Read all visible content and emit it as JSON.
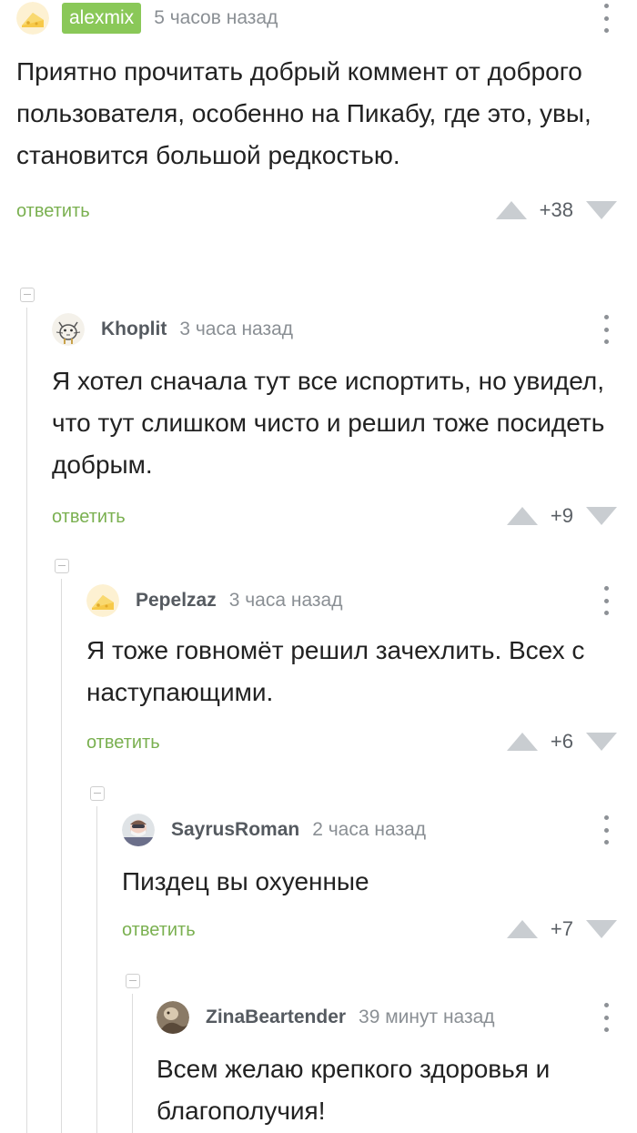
{
  "comments": [
    {
      "username": "alexmix",
      "time": "5 часов назад",
      "text": "Приятно прочитать добрый коммент от доброго пользователя, особенно на Пикабу, где это, увы, становится большой редкостью.",
      "reply_label": "ответить",
      "score": "+38",
      "avatar_icon": "cheese-icon"
    },
    {
      "username": "Khoplit",
      "time": "3 часа назад",
      "text": "Я хотел сначала тут все испортить, но увидел, что тут слишком чисто и решил тоже посидеть добрым.",
      "reply_label": "ответить",
      "score": "+9",
      "avatar_icon": "cat-sketch-icon"
    },
    {
      "username": "Pepelzaz",
      "time": "3 часа назад",
      "text": "Я тоже говномёт решил зачехлить. Всех с наступающими.",
      "reply_label": "ответить",
      "score": "+6",
      "avatar_icon": "cheese-icon"
    },
    {
      "username": "SayrusRoman",
      "time": "2 часа назад",
      "text": "Пиздец вы охуенные",
      "reply_label": "ответить",
      "score": "+7",
      "avatar_icon": "masked-person-icon"
    },
    {
      "username": "ZinaBeartender",
      "time": "39 минут назад",
      "text": "Всем желаю крепкого здоровья и благополучия!",
      "avatar_icon": "photo-avatar-icon"
    }
  ],
  "colors": {
    "accent_green": "#8ac858",
    "reply_green": "#7ab050",
    "vote_gray": "#c9cdd1",
    "thread_line": "#dcdcdc"
  }
}
